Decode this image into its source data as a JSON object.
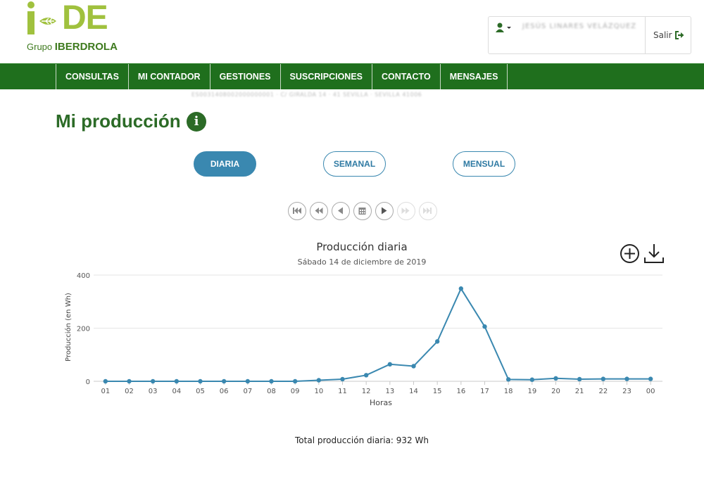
{
  "brand": {
    "logo_text": "DE",
    "logo_prefix": "i",
    "group_prefix": "Grupo",
    "group_name": "IBERDROLA"
  },
  "user": {
    "name": "JESÚS LINARES VELÁZQUEZ",
    "logout_label": "Salir"
  },
  "nav": {
    "items": [
      "CONSULTAS",
      "MI CONTADOR",
      "GESTIONES",
      "SUSCRIPCIONES",
      "CONTACTO",
      "MENSAJES"
    ]
  },
  "breadcrumb": "ES0031408002000000001 · C/ GIRALDA 14 · 41 SEVILLA · SEVILLA 41006",
  "page": {
    "title": "Mi producción",
    "info_glyph": "i"
  },
  "period": {
    "options": [
      "DIARIA",
      "SEMANAL",
      "MENSUAL"
    ],
    "selected": "DIARIA"
  },
  "controls": [
    "first-icon",
    "rewind-icon",
    "previous-icon",
    "calendar-icon",
    "next-icon",
    "fast-forward-icon",
    "last-icon"
  ],
  "colors": {
    "brand_green": "#2c6b27",
    "nav_green": "#1f6f1d",
    "logo_lime": "#a0c13e",
    "series_blue": "#3a88b0"
  },
  "chart_data": {
    "type": "line",
    "title": "Producción diaria",
    "subtitle": "Sábado 14 de diciembre de 2019",
    "xlabel": "Horas",
    "ylabel": "Producción (en Wh)",
    "ylim": [
      0,
      400
    ],
    "yticks": [
      0,
      200,
      400
    ],
    "grid": true,
    "categories": [
      "01",
      "02",
      "03",
      "04",
      "05",
      "06",
      "07",
      "08",
      "09",
      "10",
      "11",
      "12",
      "13",
      "14",
      "15",
      "16",
      "17",
      "18",
      "19",
      "20",
      "21",
      "22",
      "23",
      "00"
    ],
    "values": [
      0,
      0,
      0,
      0,
      0,
      0,
      0,
      0,
      0,
      4,
      8,
      23,
      64,
      57,
      150,
      349,
      206,
      7,
      6,
      11,
      8,
      9,
      9,
      9
    ]
  },
  "total_label": "Total producción diaria: 932 Wh"
}
